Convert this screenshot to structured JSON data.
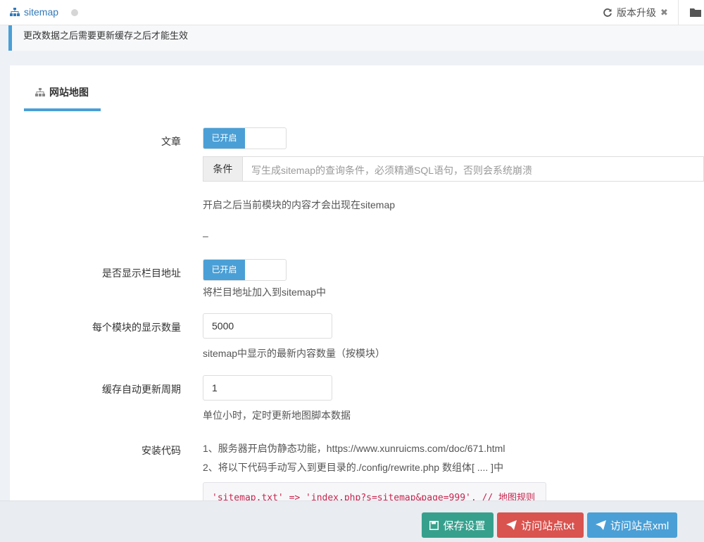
{
  "topbar": {
    "title": "sitemap",
    "title_icon": "sitemap-icon",
    "upgrade_label": "版本升级",
    "close_glyph": "✖"
  },
  "notice": {
    "text": "更改数据之后需要更新缓存之后才能生效"
  },
  "tab": {
    "label": "网站地图"
  },
  "form": {
    "article": {
      "label": "文章",
      "switch_label": "已开启",
      "condition_addon": "条件",
      "condition_placeholder": "写生成sitemap的查询条件，必须精通SQL语句，否则会系统崩溃",
      "help": "开启之后当前模块的内容才会出现在sitemap",
      "dash": "–"
    },
    "show_category": {
      "label": "是否显示栏目地址",
      "switch_label": "已开启",
      "help": "将栏目地址加入到sitemap中"
    },
    "per_module": {
      "label": "每个模块的显示数量",
      "value": "5000",
      "help": "sitemap中显示的最新内容数量（按模块）"
    },
    "cache_period": {
      "label": "缓存自动更新周期",
      "value": "1",
      "help": "单位小时，定时更新地图脚本数据"
    },
    "install": {
      "label": "安装代码",
      "line1": "1、服务器开启伪静态功能，https://www.xunruicms.com/doc/671.html",
      "line2": "2、将以下代码手动写入到更目录的./config/rewrite.php 数组体[ .... ]中",
      "code": "'sitemap.txt' => 'index.php?s=sitemap&page=999', // 地图规则"
    }
  },
  "footer": {
    "save_label": "保存设置",
    "visit_txt_label": "访问站点txt",
    "visit_xml_label": "访问站点xml"
  },
  "colors": {
    "accent": "#4a9fd6",
    "save": "#36a08d",
    "danger": "#d9534f"
  }
}
